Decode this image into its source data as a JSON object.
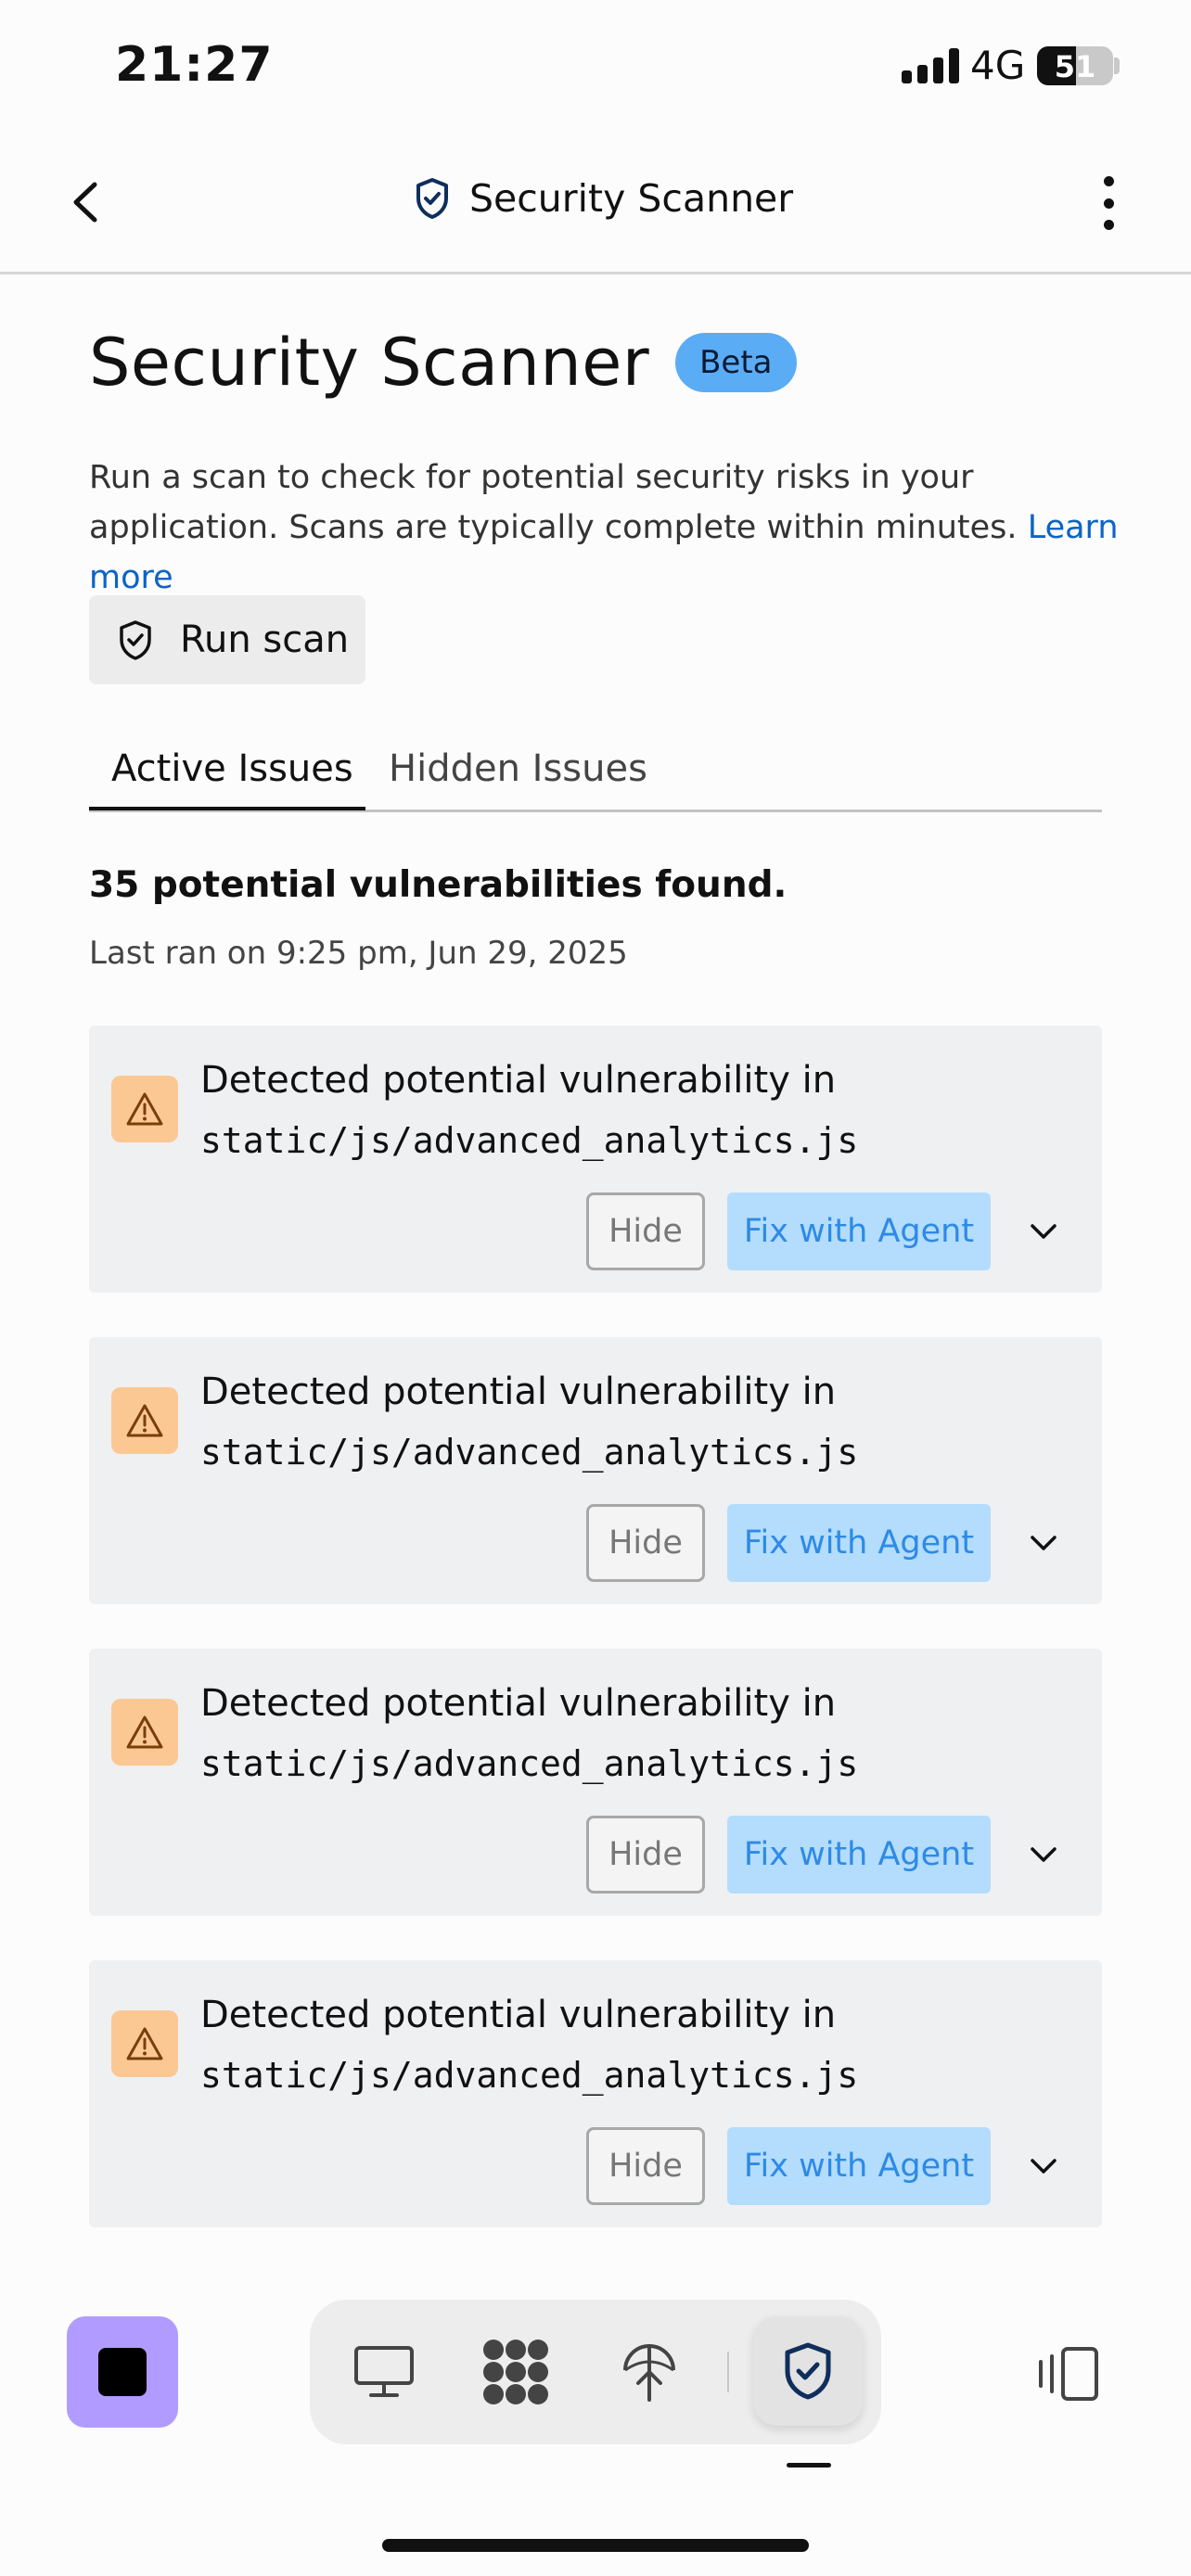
{
  "status_bar": {
    "time": "21:27",
    "network": "4G",
    "battery": "51",
    "battery_level": 0.51
  },
  "header": {
    "title": "Security Scanner",
    "back_icon": "chevron-left-icon",
    "title_icon": "shield-check-icon",
    "menu_icon": "more-vertical-icon"
  },
  "page": {
    "title": "Security Scanner",
    "badge": "Beta",
    "description": "Run a scan to check for potential security risks in your application. Scans are typically complete within minutes.",
    "learn_more": "Learn more",
    "run_scan_label": "Run scan"
  },
  "tabs": [
    {
      "label": "Active Issues",
      "active": true
    },
    {
      "label": "Hidden Issues",
      "active": false
    }
  ],
  "summary": {
    "title": "35 potential vulnerabilities found.",
    "last_ran": "Last ran on 9:25 pm, Jun 29, 2025"
  },
  "issues": [
    {
      "title": "Detected potential vulnerability in",
      "path": "static/js/advanced_analytics.js",
      "hide_label": "Hide",
      "fix_label": "Fix with Agent"
    },
    {
      "title": "Detected potential vulnerability in",
      "path": "static/js/advanced_analytics.js",
      "hide_label": "Hide",
      "fix_label": "Fix with Agent"
    },
    {
      "title": "Detected potential vulnerability in",
      "path": "static/js/advanced_analytics.js",
      "hide_label": "Hide",
      "fix_label": "Fix with Agent"
    },
    {
      "title": "Detected potential vulnerability in",
      "path": "static/js/advanced_analytics.js",
      "hide_label": "Hide",
      "fix_label": "Fix with Agent"
    }
  ],
  "toolbar": {
    "items": [
      "monitor-icon",
      "grid-icon",
      "deploy-icon",
      "shield-check-icon"
    ],
    "active_item": "shield-check-icon"
  },
  "colors": {
    "accent": "#5aacf5",
    "link": "#0b64c7",
    "fix_button_bg": "#b3dcfd",
    "warning_bg": "#fbc893",
    "stop_button": "#b19bff"
  }
}
